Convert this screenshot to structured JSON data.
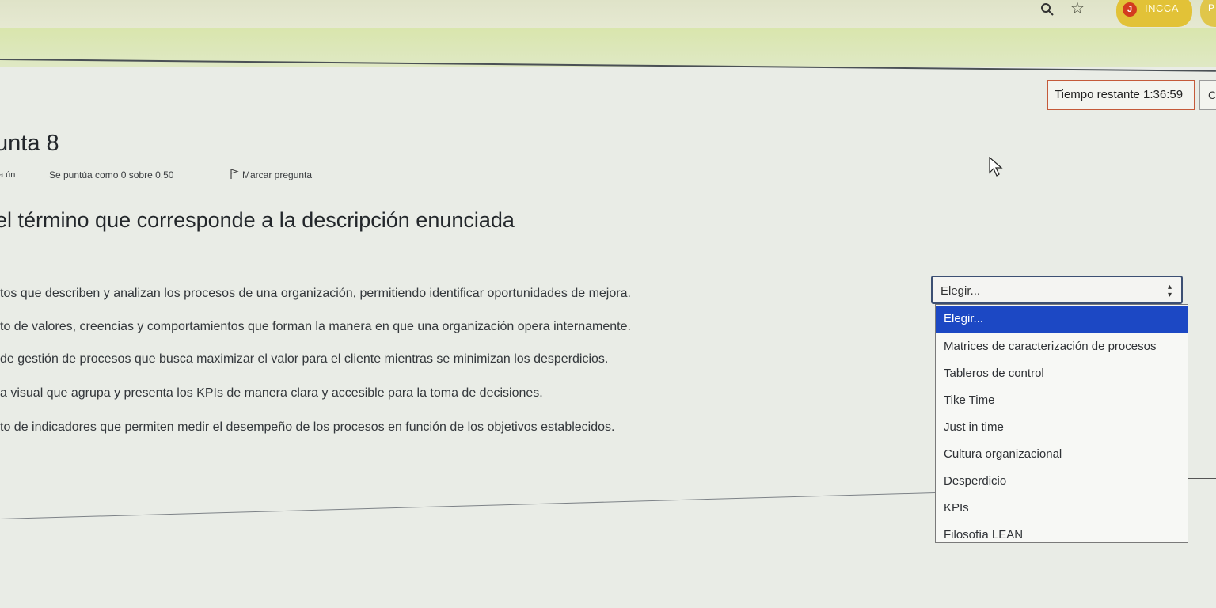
{
  "browser": {
    "profile_initial": "J",
    "profile_name": "INCCA",
    "extra_label": "P"
  },
  "quiz": {
    "timer_label": "Tiempo restante 1:36:59",
    "timer_side": "C",
    "question_title": "unta 8",
    "status": "a ún",
    "score": "Se puntúa como 0 sobre 0,50",
    "flag_label": "Marcar pregunta",
    "prompt": "el término que corresponde a la descripción enunciada",
    "items": [
      "tos que describen y analizan los procesos de una organización, permitiendo identificar oportunidades de mejora.",
      "to de valores, creencias y comportamientos que forman la manera en que una organización opera internamente.",
      "de gestión de procesos que busca maximizar el valor para el cliente mientras se minimizan los desperdicios.",
      "a visual que agrupa y presenta los KPIs de manera clara y accesible para la toma de decisiones.",
      "to de indicadores que permiten medir el desempeño de los procesos en función de los objetivos establecidos."
    ],
    "select_value": "Elegir...",
    "options": [
      "Elegir...",
      "Matrices de caracterización de procesos",
      "Tableros de control",
      "Tike Time",
      "Just in time",
      "Cultura organizacional",
      "Desperdicio",
      "KPIs",
      "Filosofía LEAN"
    ],
    "selected_color": "#1c48c4"
  }
}
